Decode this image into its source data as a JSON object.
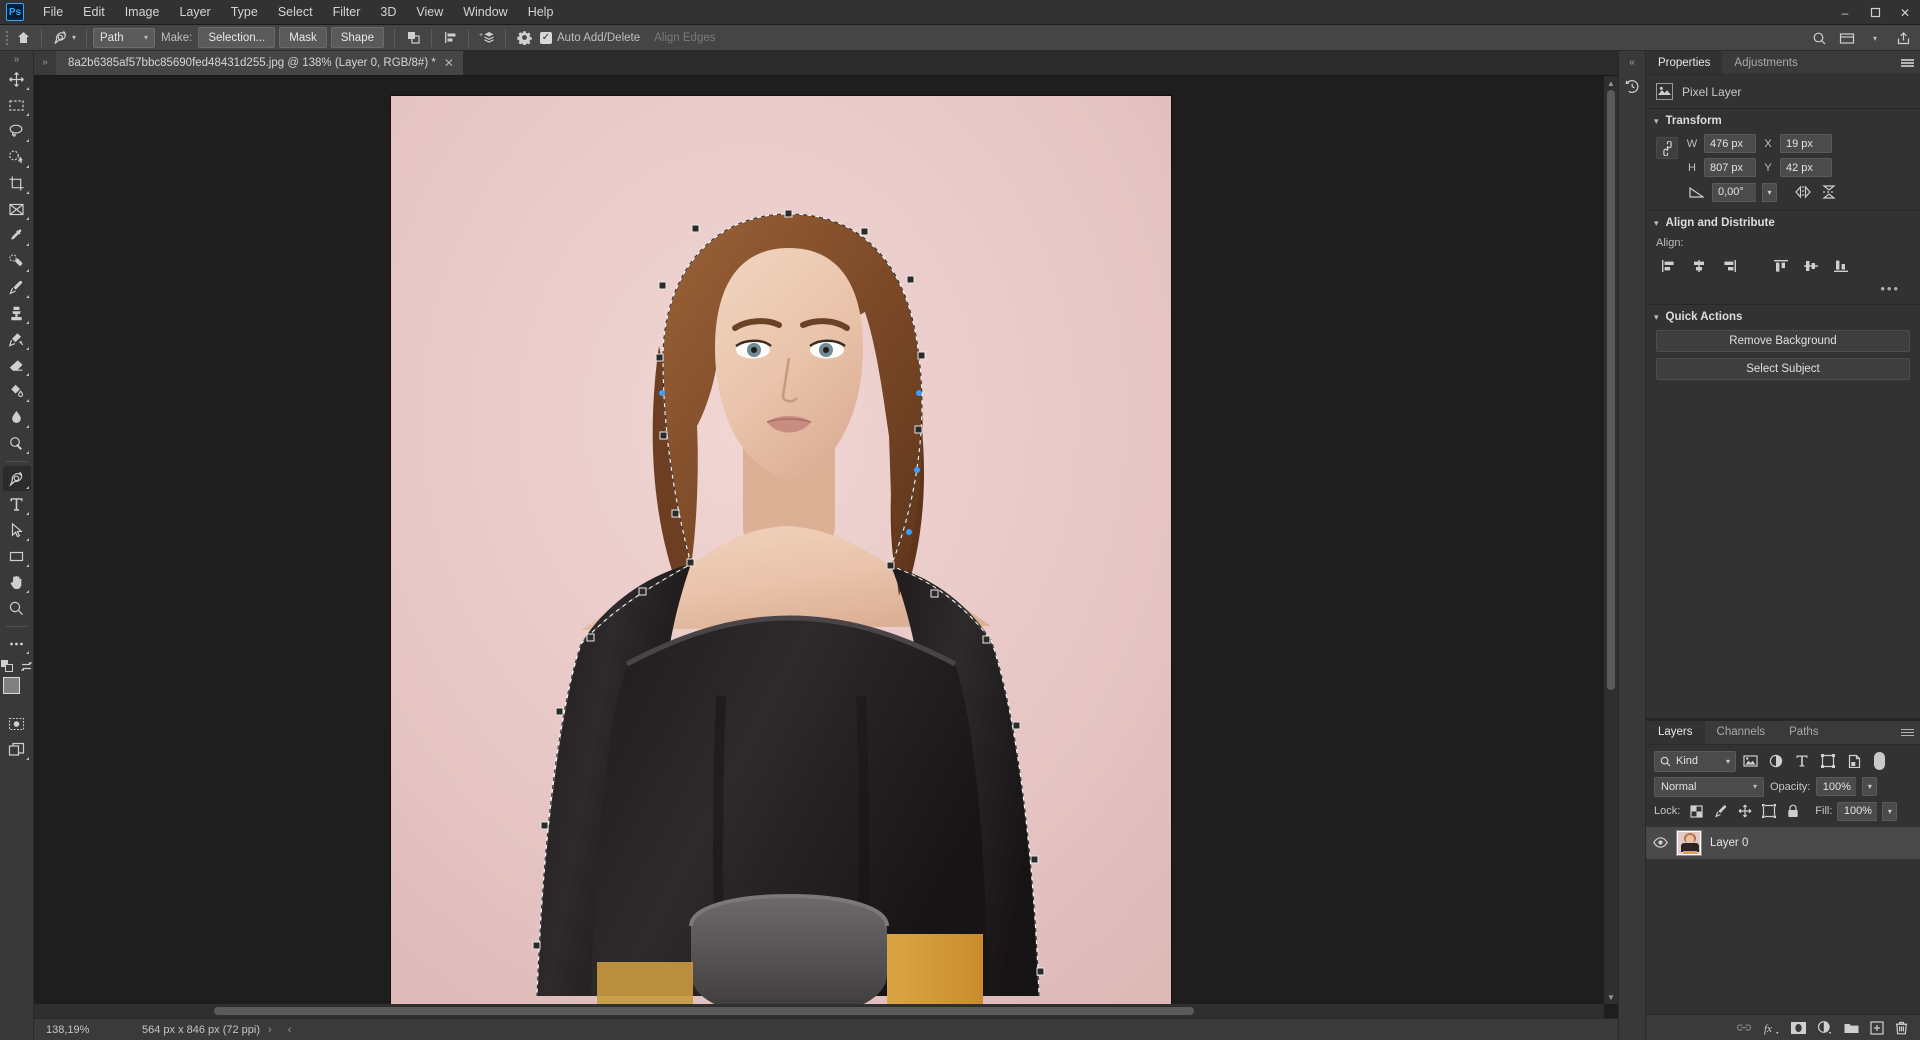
{
  "app": {
    "logo": "Ps"
  },
  "menubar": {
    "items": [
      "File",
      "Edit",
      "Image",
      "Layer",
      "Type",
      "Select",
      "Filter",
      "3D",
      "View",
      "Window",
      "Help"
    ],
    "window_controls": {
      "minimize": "–",
      "maximize": "❐",
      "close": "✕"
    }
  },
  "options_bar": {
    "path_mode": "Path",
    "make_label": "Make:",
    "selection_button": "Selection...",
    "mask_button": "Mask",
    "shape_button": "Shape",
    "auto_add_delete": "Auto Add/Delete",
    "auto_add_delete_checked": true,
    "align_edges": "Align Edges",
    "align_edges_enabled": false
  },
  "document": {
    "tab_title": "8a2b6385af57bbc85690fed48431d255.jpg @ 138% (Layer 0, RGB/8#) *",
    "close_glyph": "✕"
  },
  "status_bar": {
    "zoom": "138,19%",
    "doc_size": "564 px x 846 px (72 ppi)",
    "arrow_right": "›",
    "arrow_left": "‹"
  },
  "toolbar": {
    "tools": [
      {
        "name": "move-tool",
        "label": "Move Tool"
      },
      {
        "name": "rectangular-marquee-tool",
        "label": "Rectangular Marquee Tool"
      },
      {
        "name": "lasso-tool",
        "label": "Lasso Tool"
      },
      {
        "name": "object-selection-tool",
        "label": "Object Selection Tool"
      },
      {
        "name": "crop-tool",
        "label": "Crop Tool"
      },
      {
        "name": "frame-tool",
        "label": "Frame Tool"
      },
      {
        "name": "eyedropper-tool",
        "label": "Eyedropper Tool"
      },
      {
        "name": "spot-healing-brush-tool",
        "label": "Spot Healing Brush Tool"
      },
      {
        "name": "brush-tool",
        "label": "Brush Tool"
      },
      {
        "name": "clone-stamp-tool",
        "label": "Clone Stamp Tool"
      },
      {
        "name": "history-brush-tool",
        "label": "History Brush Tool"
      },
      {
        "name": "eraser-tool",
        "label": "Eraser Tool"
      },
      {
        "name": "gradient-tool",
        "label": "Gradient Tool"
      },
      {
        "name": "blur-tool",
        "label": "Blur Tool"
      },
      {
        "name": "dodge-tool",
        "label": "Dodge Tool"
      },
      {
        "name": "pen-tool",
        "label": "Pen Tool",
        "active": true
      },
      {
        "name": "type-tool",
        "label": "Horizontal Type Tool"
      },
      {
        "name": "path-selection-tool",
        "label": "Path Selection Tool"
      },
      {
        "name": "rectangle-tool",
        "label": "Rectangle Tool"
      },
      {
        "name": "hand-tool",
        "label": "Hand Tool"
      },
      {
        "name": "zoom-tool",
        "label": "Zoom Tool"
      },
      {
        "name": "edit-toolbar-tool",
        "label": "Edit Toolbar"
      }
    ],
    "foreground_color": "#808080",
    "background_color": "#000000"
  },
  "properties_panel": {
    "tabs": [
      {
        "label": "Properties",
        "active": true
      },
      {
        "label": "Adjustments",
        "active": false
      }
    ],
    "layer_type": "Pixel Layer",
    "transform": {
      "title": "Transform",
      "w_label": "W",
      "w_value": "476 px",
      "h_label": "H",
      "h_value": "807 px",
      "x_label": "X",
      "x_value": "19 px",
      "y_label": "Y",
      "y_value": "42 px",
      "angle_value": "0,00°"
    },
    "align_distribute": {
      "title": "Align and Distribute",
      "align_label": "Align:",
      "icons": [
        "align-left-edges-icon",
        "align-horizontal-centers-icon",
        "align-right-edges-icon",
        "align-top-edges-icon",
        "align-vertical-centers-icon",
        "align-bottom-edges-icon"
      ],
      "more": "•••"
    },
    "quick_actions": {
      "title": "Quick Actions",
      "buttons": [
        "Remove Background",
        "Select Subject"
      ]
    }
  },
  "layers_panel": {
    "tabs": [
      {
        "label": "Layers",
        "active": true
      },
      {
        "label": "Channels",
        "active": false
      },
      {
        "label": "Paths",
        "active": false
      }
    ],
    "filter_kind": "Kind",
    "filter_icons": [
      "filter-pixel-icon",
      "filter-adjustment-icon",
      "filter-type-icon",
      "filter-shape-icon",
      "filter-smart-object-icon"
    ],
    "blend_mode": "Normal",
    "opacity_label": "Opacity:",
    "opacity_value": "100%",
    "lock_label": "Lock:",
    "lock_icons": [
      "lock-transparent-pixels-icon",
      "lock-image-pixels-icon",
      "lock-position-icon",
      "lock-artboard-nesting-icon",
      "lock-all-icon"
    ],
    "fill_label": "Fill:",
    "fill_value": "100%",
    "layers": [
      {
        "name": "Layer 0",
        "visible": true,
        "selected": true
      }
    ],
    "footer_icons": [
      "link-layers-icon",
      "add-layer-style-icon",
      "add-layer-mask-icon",
      "new-fill-adjustment-icon",
      "new-group-icon",
      "new-layer-icon",
      "delete-layer-icon"
    ],
    "footer_fx_label": "fx"
  },
  "dock_strip": {
    "collapse": "«",
    "icons": [
      "history-icon"
    ]
  },
  "canvas": {
    "image_alt": "Portrait photo of a woman in a black off-shoulder top on pink background",
    "path_active": true,
    "background_color": "#e7c7c7"
  }
}
